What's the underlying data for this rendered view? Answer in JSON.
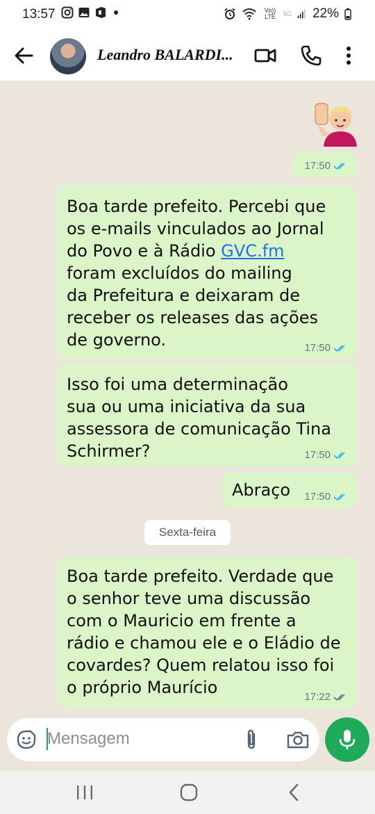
{
  "status_bar": {
    "time": "13:57",
    "volte_label": "Vo)) LTE",
    "network": "5G",
    "battery": "22%"
  },
  "header": {
    "contact_name": "Leandro BALARDI..."
  },
  "messages": [
    {
      "text": "",
      "time": "17:50",
      "emoji": "raised-hand-emoji"
    },
    {
      "text_before_link": "Boa tarde prefeito.  Percebi que\nos e-mails vinculados ao Jornal\ndo Povo e à Rádio ",
      "link": "GVC.fm",
      "text_after_link": "\nforam excluídos do mailing\nda Prefeitura e deixaram de\nreceber os releases das ações\nde governo.",
      "time": "17:50"
    },
    {
      "text": "Isso foi uma determinação\nsua ou uma iniciativa da sua\nassessora de comunicação Tina\nSchirmer?",
      "time": "17:50"
    },
    {
      "text": "Abraço",
      "time": "17:50"
    },
    {
      "text": "Boa tarde prefeito.  Verdade que\no senhor teve uma discussão\ncom o Mauricio em frente a\nrádio e chamou ele e o Eládio de\ncovardes? Quem relatou isso foi\no próprio Maurício",
      "time": "17:22"
    }
  ],
  "date_separator": "Sexta-feira",
  "composer": {
    "placeholder": "Mensagem"
  },
  "colors": {
    "outgoing_bubble": "#dbf5c8",
    "tick_read": "#34b7f1",
    "tick_delivered": "#667781",
    "mic_button": "#1faa59",
    "link": "#1a73e8"
  }
}
